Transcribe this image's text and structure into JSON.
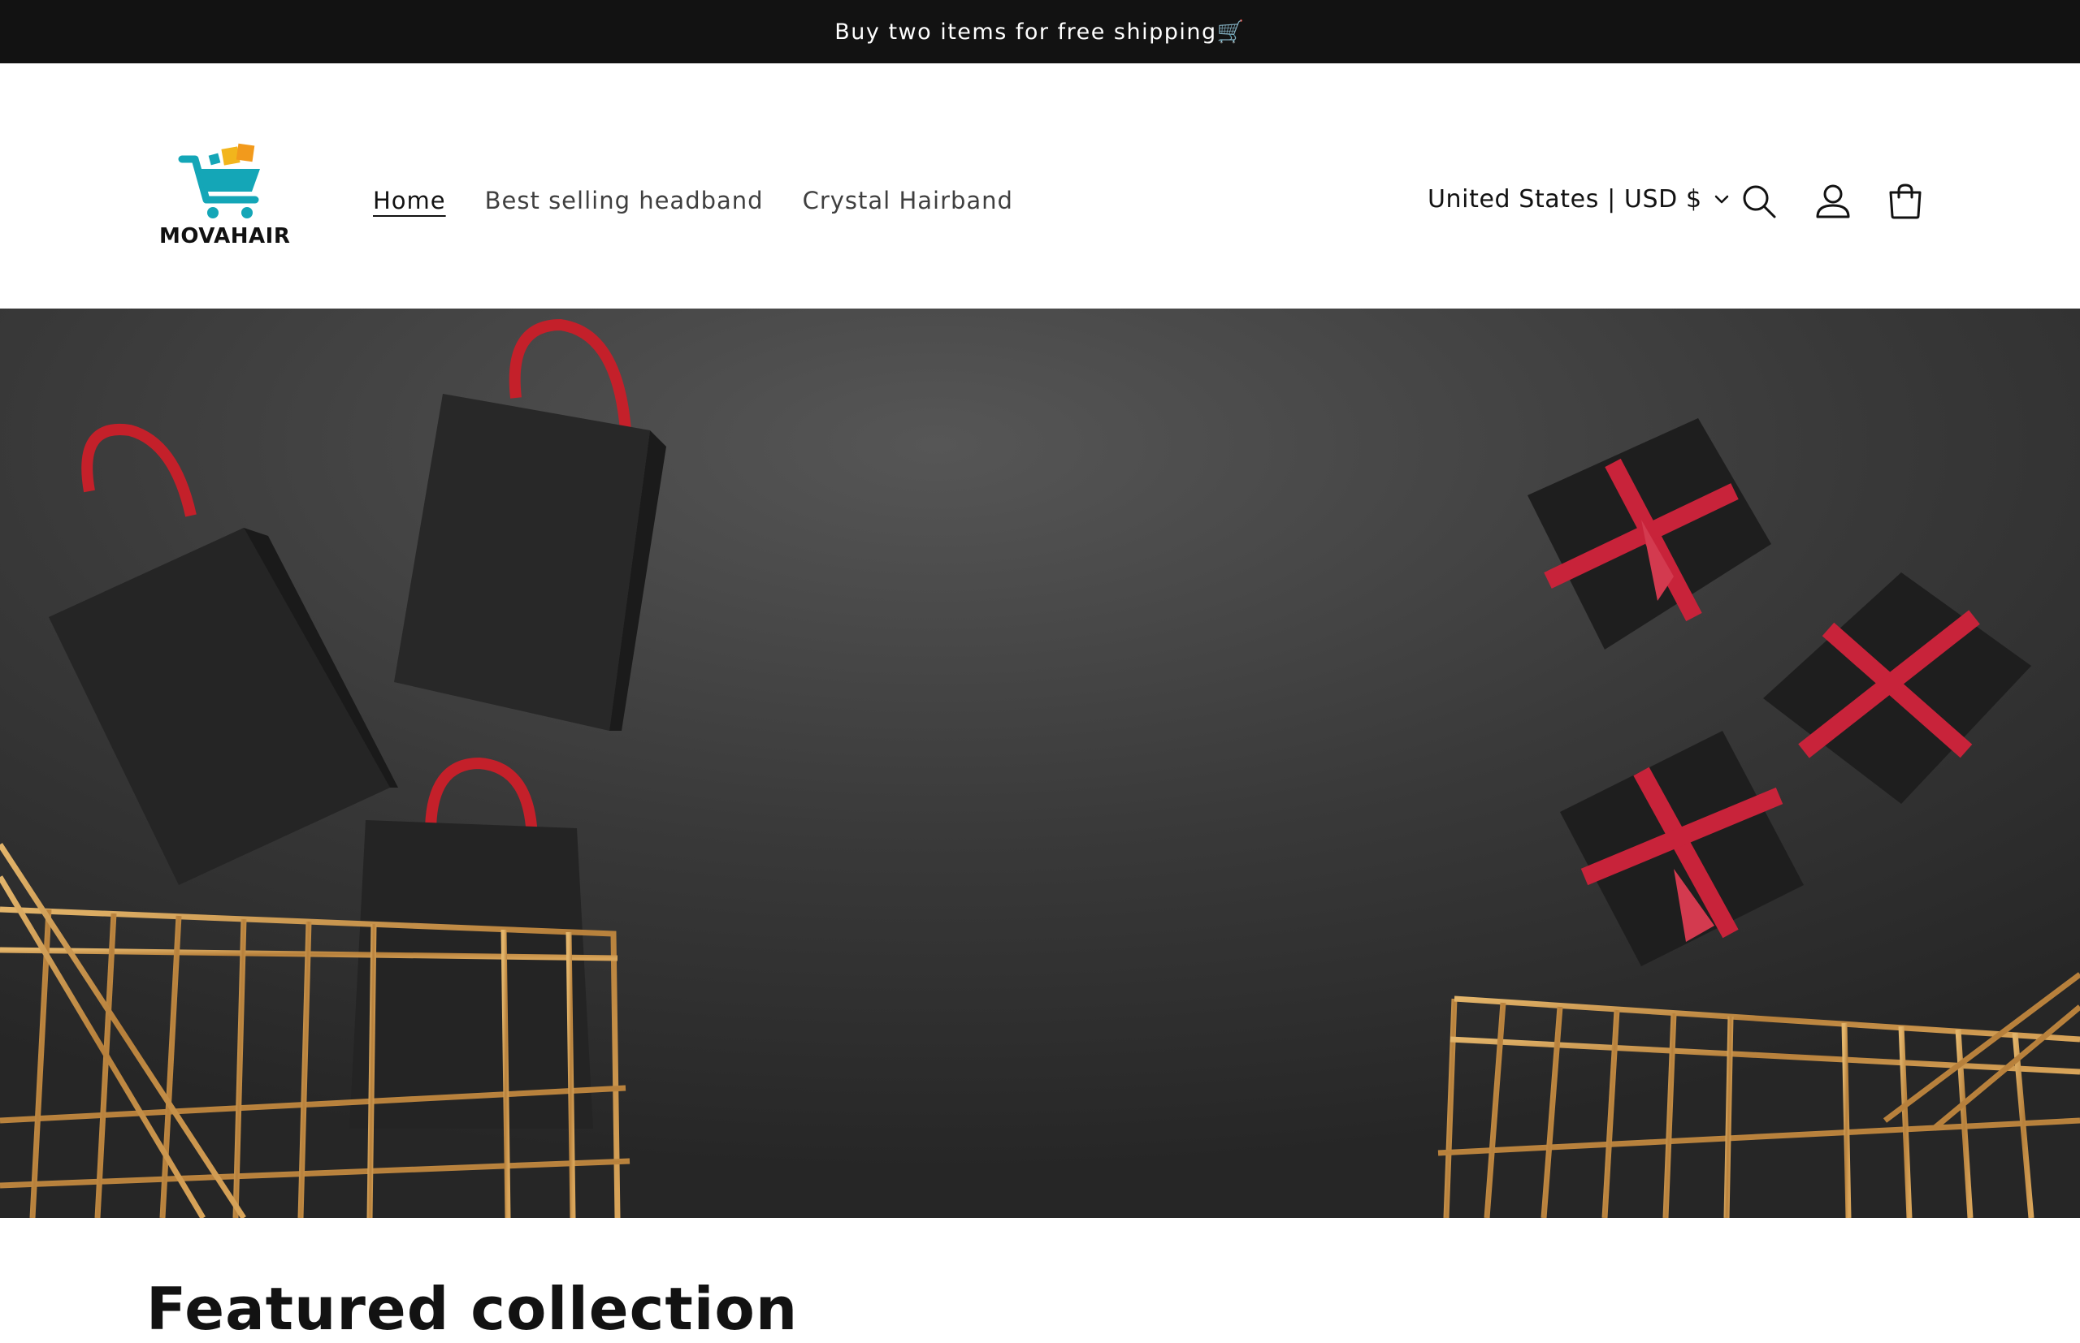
{
  "announcement": {
    "text": "Buy two items for free shipping🛒"
  },
  "header": {
    "logo": {
      "brand": "MOVAHAIR",
      "icon": "shopping-cart-icon"
    },
    "nav": [
      {
        "label": "Home",
        "active": true
      },
      {
        "label": "Best selling headband",
        "active": false
      },
      {
        "label": "Crystal Hairband",
        "active": false
      }
    ],
    "country_currency": "United States | USD $",
    "icons": [
      "search-icon",
      "account-icon",
      "cart-icon"
    ]
  },
  "hero": {
    "image": "shopping-bags-and-gift-boxes-with-gold-carts"
  },
  "featured": {
    "heading": "Featured collection"
  },
  "colors": {
    "announcement_bg": "#121212",
    "hero_bg": "#3a3a3a",
    "ribbon_red": "#c8233a",
    "cart_gold": "#c9944a",
    "logo_teal": "#14a6b7",
    "logo_yellow": "#f2b51c"
  }
}
